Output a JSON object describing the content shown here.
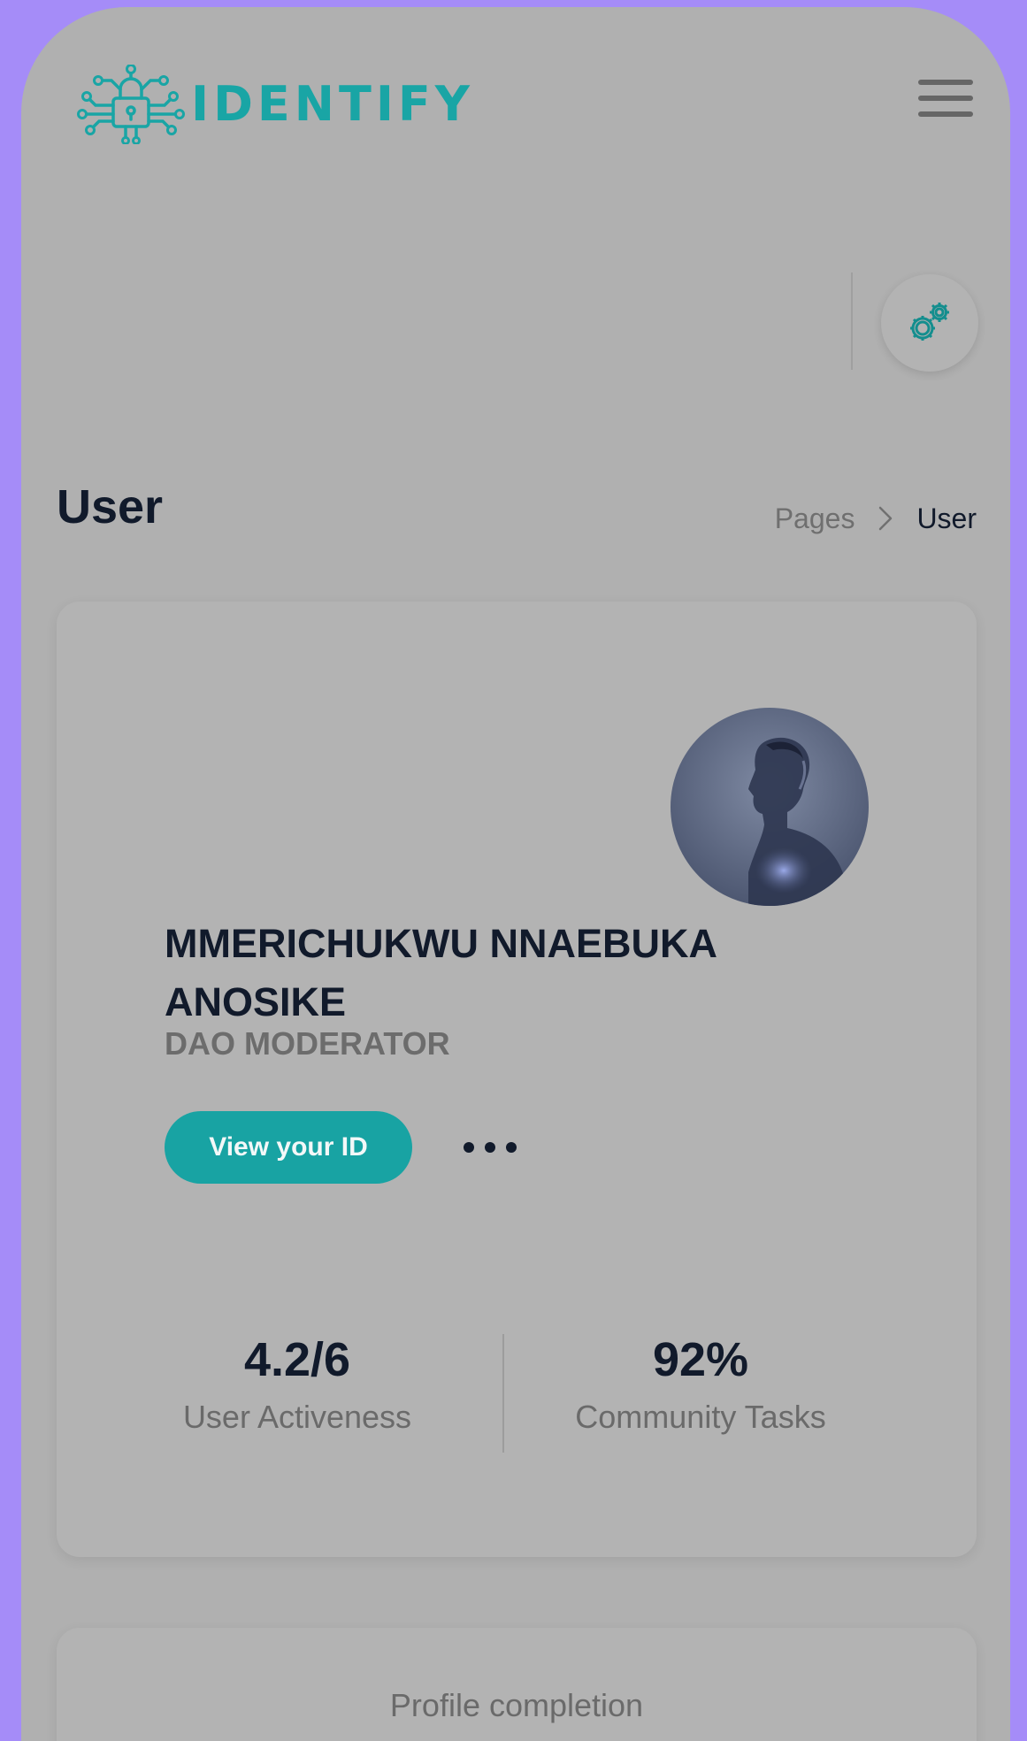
{
  "header": {
    "logo_text": "IDENTIFY",
    "logo_icon": "circuit-lock-icon",
    "menu_icon": "hamburger-icon",
    "settings_icon": "gears-icon"
  },
  "page": {
    "title": "User",
    "breadcrumb": {
      "parent": "Pages",
      "current": "User"
    }
  },
  "profile": {
    "name": "MMERICHUKWU NNAEBUKA ANOSIKE",
    "role": "DAO MODERATOR",
    "view_id_label": "View your ID",
    "more_icon": "ellipsis-icon",
    "stats": [
      {
        "value": "4.2/6",
        "label": "User Activeness"
      },
      {
        "value": "92%",
        "label": "Community Tasks"
      }
    ]
  },
  "completion": {
    "title": "Profile completion"
  },
  "colors": {
    "accent": "#18a3a3",
    "background": "#a58cf8",
    "surface": "#b0b0b0",
    "text_dark": "#111a2b"
  }
}
